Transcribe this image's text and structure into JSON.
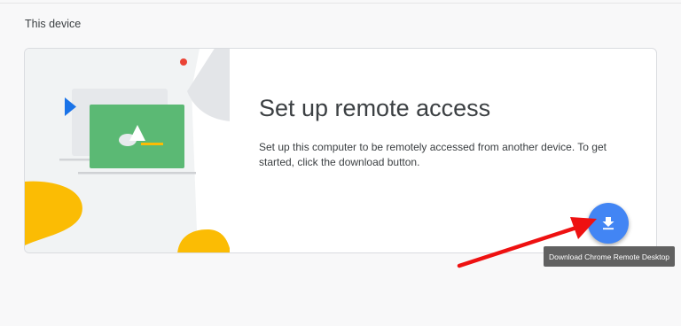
{
  "section": {
    "title": "This device"
  },
  "card": {
    "heading": "Set up remote access",
    "description": "Set up this computer to be remotely accessed from another device. To get started, click the download button."
  },
  "download_button": {
    "icon": "download-icon",
    "tooltip": "Download Chrome Remote Desktop",
    "color": "#4285f4"
  },
  "annotation": {
    "type": "red-arrow",
    "color": "#ee1111",
    "points_to": "download_button"
  },
  "colors": {
    "illustration_bg": "#f1f3f4",
    "monitor_green": "#5bb974",
    "accent_yellow": "#fbbc04",
    "accent_blue": "#1a73e8",
    "accent_red": "#ea4335"
  }
}
